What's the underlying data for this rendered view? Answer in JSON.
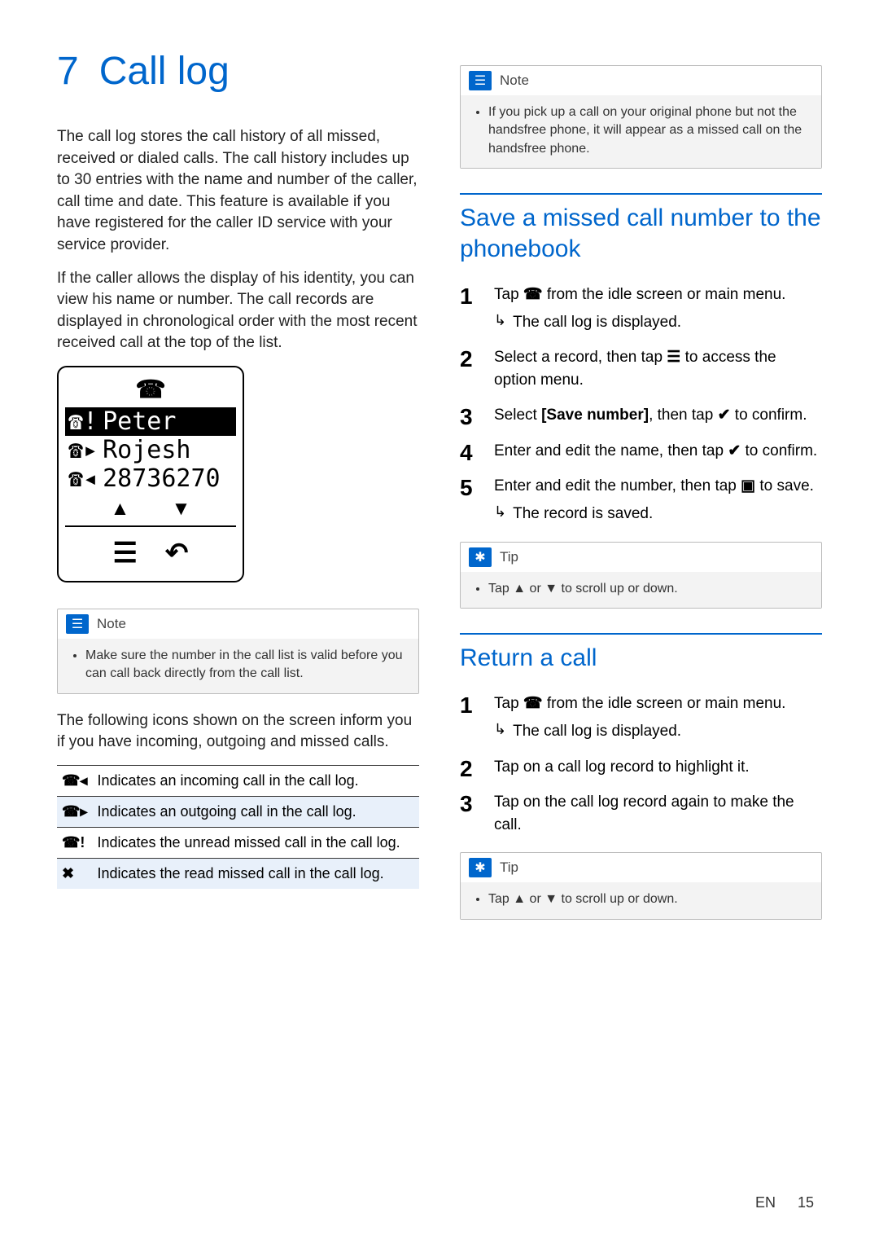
{
  "chapter": {
    "num": "7",
    "title": "Call log"
  },
  "intro1": "The call log stores the call history of all missed, received or dialed calls. The call history includes up to 30 entries with the name and number of the caller, call time and date. This feature is available if you have registered for the caller ID service with your service provider.",
  "intro2": "If the caller allows the display of his identity, you can view his name or number. The call records are displayed in chronological order with the most recent received call at the top of the list.",
  "phone": {
    "line1": "Peter",
    "line2": "Rojesh",
    "line3": "28736270"
  },
  "note1": {
    "label": "Note",
    "body": "Make sure the number in the call list is valid before you can call back directly from the call list."
  },
  "icons_intro": "The following icons shown on the screen inform you if you have incoming, outgoing and missed calls.",
  "icon_rows": [
    "Indicates an incoming call in the call log.",
    "Indicates an outgoing call in the call log.",
    "Indicates the unread missed call in the call log.",
    "Indicates the read missed call in the call log."
  ],
  "note2": {
    "label": "Note",
    "body": "If you pick up a call on your original phone but not the handsfree phone, it will appear as a missed call on the handsfree phone."
  },
  "sectionA": {
    "title": "Save a missed call number to the phonebook",
    "steps": {
      "s1a": "Tap ",
      "s1b": " from the idle screen or main menu.",
      "s1r": "The call log is displayed.",
      "s2a": "Select a record, then tap ",
      "s2b": " to access the option menu.",
      "s3a": "Select ",
      "s3opt": "[Save number]",
      "s3b": ", then tap ",
      "s3c": " to confirm.",
      "s4a": "Enter and edit the name, then tap ",
      "s4b": " to confirm.",
      "s5a": "Enter and edit the number, then tap ",
      "s5b": " to save.",
      "s5r": "The record is saved."
    }
  },
  "tip1": {
    "label": "Tip",
    "body_a": "Tap ",
    "body_mid": " or ",
    "body_b": " to scroll up or down."
  },
  "sectionB": {
    "title": "Return a call",
    "steps": {
      "s1a": "Tap ",
      "s1b": " from the idle screen or main menu.",
      "s1r": "The call log is displayed.",
      "s2": "Tap on a call log record to highlight it.",
      "s3": "Tap on the call log record again to make the call."
    }
  },
  "tip2": {
    "label": "Tip",
    "body_a": "Tap ",
    "body_mid": " or ",
    "body_b": " to scroll up or down."
  },
  "footer": {
    "lang": "EN",
    "page": "15"
  }
}
